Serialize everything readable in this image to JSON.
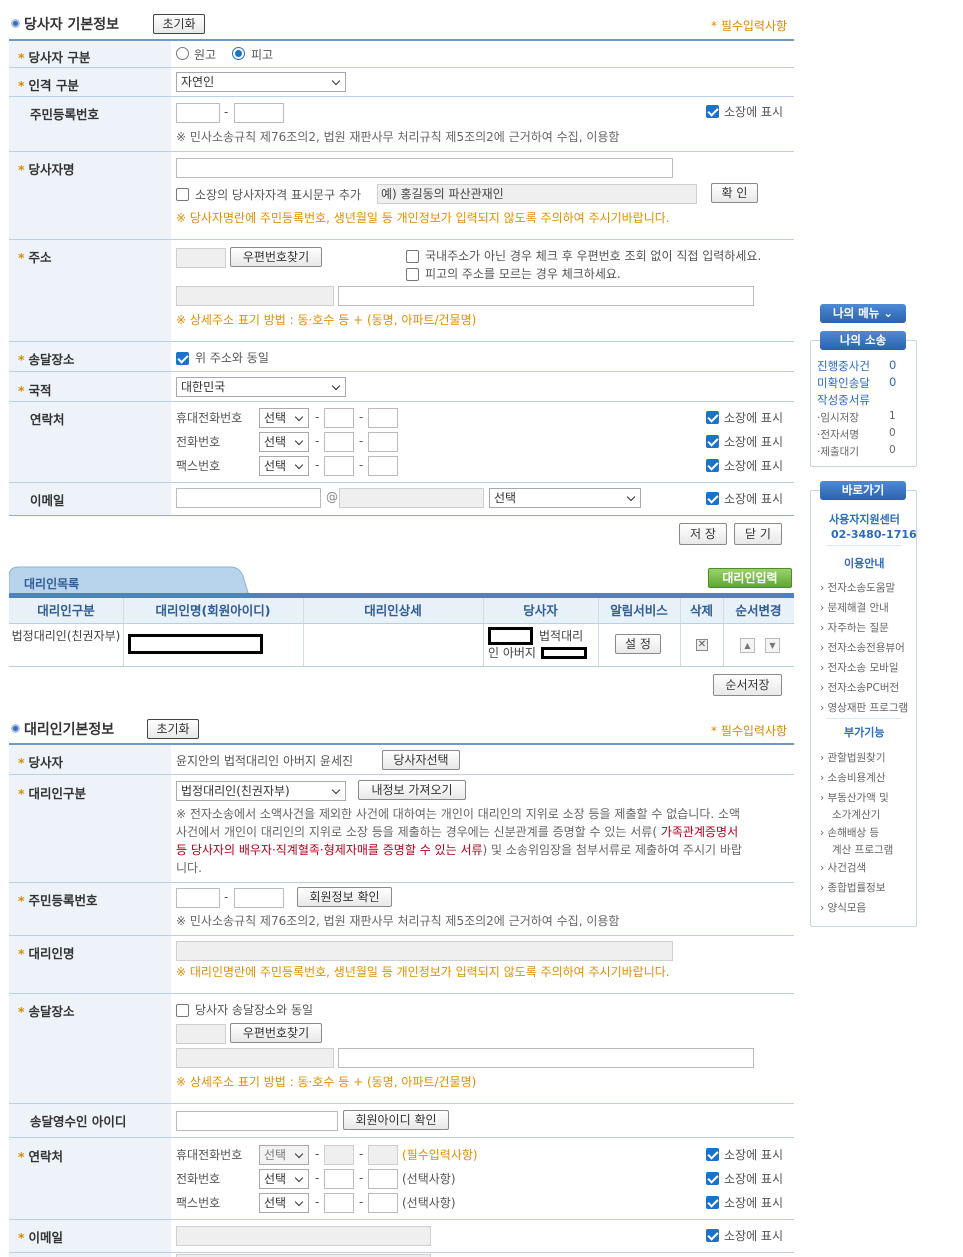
{
  "section1": {
    "title": "당사자 기본정보",
    "reset_label": "초기화",
    "required_note": "* 필수입력사항"
  },
  "party_type": {
    "label": "당사자 구분",
    "options": [
      "원고",
      "피고"
    ],
    "selected": "피고"
  },
  "person_type": {
    "label": "인격 구분",
    "value": "자연인"
  },
  "rrn": {
    "label": "주민등록번호",
    "show_label": "소장에 표시",
    "note": "※ 민사소송규칙 제76조의2, 법원 재판사무 처리규칙 제5조의2에 근거하여 수집, 이용함"
  },
  "party_name": {
    "label": "당사자명",
    "qual_label": "소장의 당사자자격 표시문구 추가",
    "qual_placeholder": "예) 홍길동의 파산관재인",
    "confirm_label": "확 인",
    "warning": "※ 당사자명란에 주민등록번호, 생년월일 등 개인정보가 입력되지 않도록 주의하여 주시기바랍니다."
  },
  "address": {
    "label": "주소",
    "zip_btn": "우편번호찾기",
    "opt1": "국내주소가 아닌 경우 체크 후 우편번호 조회 없이 직접 입력하세요.",
    "opt2": "피고의 주소를 모르는 경우 체크하세요.",
    "hint": "※ 상세주소 표기 방법 : 동·호수 등 + (동명, 아파트/건물명)"
  },
  "delivery": {
    "label": "송달장소",
    "same_label": "위 주소와 동일"
  },
  "nationality": {
    "label": "국적",
    "value": "대한민국"
  },
  "contact": {
    "label": "연락처",
    "rows": [
      {
        "name": "휴대전화번호",
        "select": "선택",
        "show": "소장에 표시"
      },
      {
        "name": "전화번호",
        "select": "선택",
        "show": "소장에 표시"
      },
      {
        "name": "팩스번호",
        "select": "선택",
        "show": "소장에 표시"
      }
    ]
  },
  "email": {
    "label": "이메일",
    "at": "@",
    "select": "선택",
    "show": "소장에 표시"
  },
  "actions": {
    "save": "저 장",
    "close": "닫 기"
  },
  "agent_list": {
    "tab": "대리인목록",
    "add_btn": "대리인입력",
    "headers": [
      "대리인구분",
      "대리인명(회원아이디)",
      "대리인상세",
      "당사자",
      "알림서비스",
      "삭제",
      "순서변경"
    ],
    "row": {
      "type": "법정대리인(친권자부)",
      "party_suffix": "법적대리인 아버지",
      "alert_btn": "설 정"
    },
    "order_save": "순서저장"
  },
  "section2": {
    "title": "대리인기본정보",
    "reset_label": "초기화",
    "required_note": "* 필수입력사항"
  },
  "agent_party": {
    "label": "당사자",
    "value": "윤지안의 법적대리인 아버지 윤세진",
    "btn": "당사자선택"
  },
  "agent_type": {
    "label": "대리인구분",
    "value": "법정대리인(친권자부)",
    "btn": "내정보 가져오기",
    "note_a": "※ 전자소송에서 소액사건을 제외한 사건에 대하여는 개인이 대리인의 지위로 소장 등을 제출할 수 없습니다. 소액",
    "note_b1": "사건에서 개인이 대리인의 지위로 소장 등을 제출하는 경우에는 신분관계를 증명할 수 있는 서류(",
    "note_b2": " 가족관계증명서",
    "note_c1": "등 당사자의 배우자·직계혈족·형제자매를 증명할 수 있는 서류",
    "note_c2": ") 및 소송위임장을 첨부서류로 제출하여 주시기 바랍",
    "note_d": "니다."
  },
  "agent_rrn": {
    "label": "주민등록번호",
    "btn": "회원정보 확인",
    "note": "※ 민사소송규칙 제76조의2, 법원 재판사무 처리규칙 제5조의2에 근거하여 수집, 이용함"
  },
  "agent_name": {
    "label": "대리인명",
    "warning": "※ 대리인명란에 주민등록번호, 생년월일 등 개인정보가 입력되지 않도록 주의하여 주시기바랍니다."
  },
  "agent_delivery": {
    "label": "송달장소",
    "same_label": "당사자 송달장소와 동일",
    "zip_btn": "우편번호찾기",
    "hint": "※ 상세주소 표기 방법 : 동·호수 등 + (동명, 아파트/건물명)"
  },
  "receiver": {
    "label": "송달영수인 아이디",
    "btn": "회원아이디 확인"
  },
  "agent_contact": {
    "label": "연락처",
    "rows": [
      {
        "name": "휴대전화번호",
        "select": "선택",
        "tag": "(필수입력사항)",
        "show": "소장에 표시"
      },
      {
        "name": "전화번호",
        "select": "선택",
        "tag": "(선택사항)",
        "show": "소장에 표시"
      },
      {
        "name": "팩스번호",
        "select": "선택",
        "tag": "(선택사항)",
        "show": "소장에 표시"
      }
    ]
  },
  "agent_email": {
    "label": "이메일",
    "show": "소장에 표시"
  },
  "sidebar": {
    "menu_btn": "나의 메뉴",
    "my_case": "나의 소송",
    "items": [
      {
        "name": "진행중사건",
        "count": "0"
      },
      {
        "name": "미확인송달",
        "count": "0"
      }
    ],
    "drafts": "작성중서류",
    "sub_items": [
      {
        "name": "·임시저장",
        "count": "1"
      },
      {
        "name": "·전자서명",
        "count": "0"
      },
      {
        "name": "·제출대기",
        "count": "0"
      }
    ],
    "shortcut": "바로가기",
    "support": "사용자지원센터",
    "phone": "02-3480-1716",
    "guide_title": "이용안내",
    "guide_links": [
      "전자소송도움말",
      "문제해결 안내",
      "자주하는 질문",
      "전자소송전용뷰어",
      "전자소송 모바일",
      "전자소송PC버전",
      "영상재판 프로그램"
    ],
    "extra_title": "부가기능",
    "extra_links": [
      "관할법원찾기",
      "소송비용계산",
      "부동산가액 및",
      "소가계산기",
      "손해배상 등",
      "계산 프로그램",
      "사건검색",
      "종합법률정보",
      "양식모음"
    ]
  }
}
